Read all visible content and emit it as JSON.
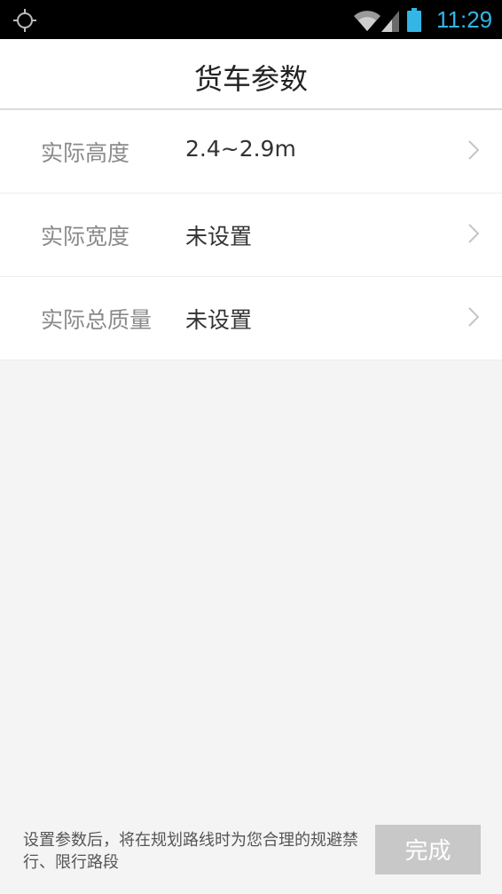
{
  "status_bar": {
    "time": "11:29",
    "icons": [
      "crosshair-icon",
      "wifi-icon",
      "signal-icon",
      "battery-icon"
    ],
    "accent_color": "#33b5e5"
  },
  "header": {
    "title": "货车参数"
  },
  "params": [
    {
      "label": "实际高度",
      "value": "2.4~2.9m"
    },
    {
      "label": "实际宽度",
      "value": "未设置"
    },
    {
      "label": "实际总质量",
      "value": "未设置"
    }
  ],
  "footer": {
    "note": "设置参数后，将在规划路线时为您合理的规避禁行、限行路段",
    "done_label": "完成"
  }
}
